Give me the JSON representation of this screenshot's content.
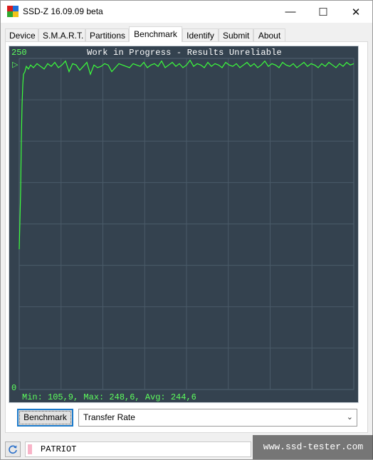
{
  "window": {
    "title": "SSD-Z 16.09.09 beta",
    "icon_name": "ssdz-app-icon",
    "controls": {
      "minimize": "—",
      "maximize": "☐",
      "close": "✕"
    }
  },
  "tabs": [
    {
      "label": "Device"
    },
    {
      "label": "S.M.A.R.T."
    },
    {
      "label": "Partitions"
    },
    {
      "label": "Benchmark",
      "active": true
    },
    {
      "label": "Identify"
    },
    {
      "label": "Submit"
    },
    {
      "label": "About"
    }
  ],
  "benchmark": {
    "chart_title": "Work in Progress - Results Unreliable",
    "y_max_label": "250",
    "y_min_label": "0",
    "marker": "▷",
    "stats_text": "Min: 105,9, Max: 248,6, Avg: 244,6",
    "button_label": "Benchmark",
    "mode_selected": "Transfer Rate"
  },
  "chart_data": {
    "type": "line",
    "title": "Work in Progress - Results Unreliable",
    "ylim": [
      0,
      250
    ],
    "grid": true,
    "series": [
      {
        "color": "#3cff3c",
        "x": [
          0,
          2,
          3,
          4,
          5,
          6,
          8,
          10,
          13,
          16,
          20,
          25,
          30,
          35,
          40,
          45,
          50,
          55,
          60,
          65,
          70,
          75,
          80,
          85,
          90,
          95,
          100,
          105,
          110,
          115,
          120,
          125,
          130,
          135,
          140,
          145,
          150,
          155,
          160,
          165,
          170,
          175,
          180,
          185,
          190,
          195,
          200,
          205,
          210,
          215,
          220,
          225,
          230,
          235,
          240,
          245,
          250,
          255,
          260,
          265,
          270,
          275,
          280,
          285,
          290,
          295,
          300,
          305,
          310,
          315,
          320,
          325,
          330,
          335,
          340,
          345,
          350,
          355,
          360,
          365,
          370,
          375,
          380,
          385,
          390,
          395,
          400,
          405,
          410,
          415,
          420,
          425,
          430,
          435,
          440,
          445,
          450,
          455,
          460,
          465,
          470
        ],
        "y": [
          105.9,
          150,
          190,
          215,
          230,
          238,
          240,
          244,
          242,
          245,
          243,
          246,
          244,
          242,
          246,
          244,
          247,
          243,
          245,
          248,
          240,
          246,
          245,
          241,
          244,
          247,
          238,
          245,
          243,
          244,
          246,
          245,
          240,
          243,
          246,
          245,
          244,
          243,
          246,
          245,
          244,
          247,
          243,
          245,
          246,
          244,
          248,
          243,
          245,
          247,
          244,
          246,
          243,
          245,
          248.6,
          244,
          246,
          245,
          243,
          247,
          244,
          246,
          245,
          243,
          247,
          245,
          244,
          246,
          243,
          245,
          247,
          244,
          246,
          243,
          245,
          248,
          244,
          246,
          245,
          243,
          247,
          245,
          244,
          246,
          243,
          245,
          247,
          244,
          246,
          245,
          243,
          246,
          244,
          247,
          245,
          243,
          246,
          244,
          247,
          245,
          246
        ]
      }
    ]
  },
  "status": {
    "refresh_icon": "refresh-icon",
    "drive_color": "#f8b4c8",
    "drive_name": "PATRIOT"
  },
  "watermark": "www.ssd-tester.com"
}
